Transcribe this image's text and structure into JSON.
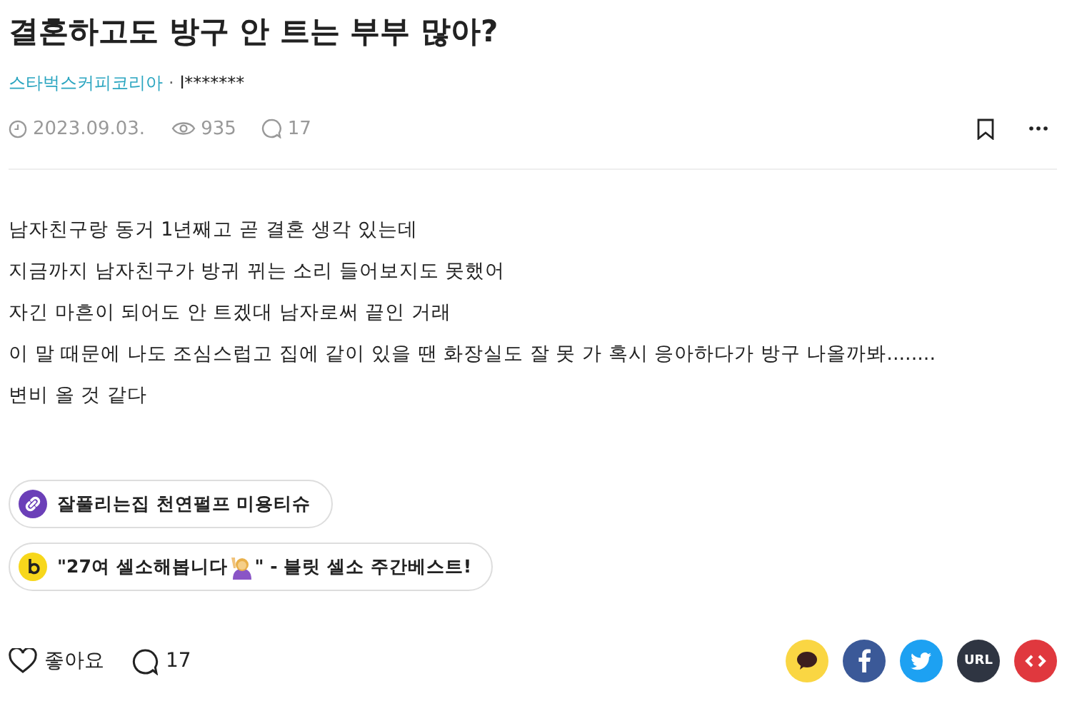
{
  "title": "결혼하고도 방구 안 트는 부부 많아?",
  "author": {
    "board": "스타벅스커피코리아",
    "separator": "·",
    "name": "l*******"
  },
  "meta": {
    "date": "2023.09.03.",
    "views": "935",
    "comments": "17"
  },
  "body": [
    "남자친구랑 동거 1년째고 곧 결혼 생각 있는데",
    "지금까지 남자친구가 방귀 뀌는 소리 들어보지도 못했어",
    "자긴 마흔이 되어도 안 트겠대 남자로써 끝인 거래",
    "이 말 때문에 나도 조심스럽고 집에 같이 있을 땐 화장실도 잘 못 가 혹시 응아하다가 방구 나올까봐........",
    "변비 올 것 같다"
  ],
  "links": [
    {
      "kind": "link",
      "text": "잘풀리는집 천연펄프 미용티슈"
    },
    {
      "kind": "blind",
      "text_before": "\"27여 셀소해봅니다",
      "text_after": "\" - 블릿 셀소 주간베스트!"
    }
  ],
  "footer": {
    "like_label": "좋아요",
    "comments": "17",
    "share": [
      {
        "kind": "kakao",
        "color": "#fad643"
      },
      {
        "kind": "facebook",
        "color": "#3b5998"
      },
      {
        "kind": "twitter",
        "color": "#1da1f2"
      },
      {
        "kind": "url",
        "color": "#2f3542",
        "label": "URL"
      },
      {
        "kind": "embed",
        "color": "#e0383e"
      }
    ]
  }
}
